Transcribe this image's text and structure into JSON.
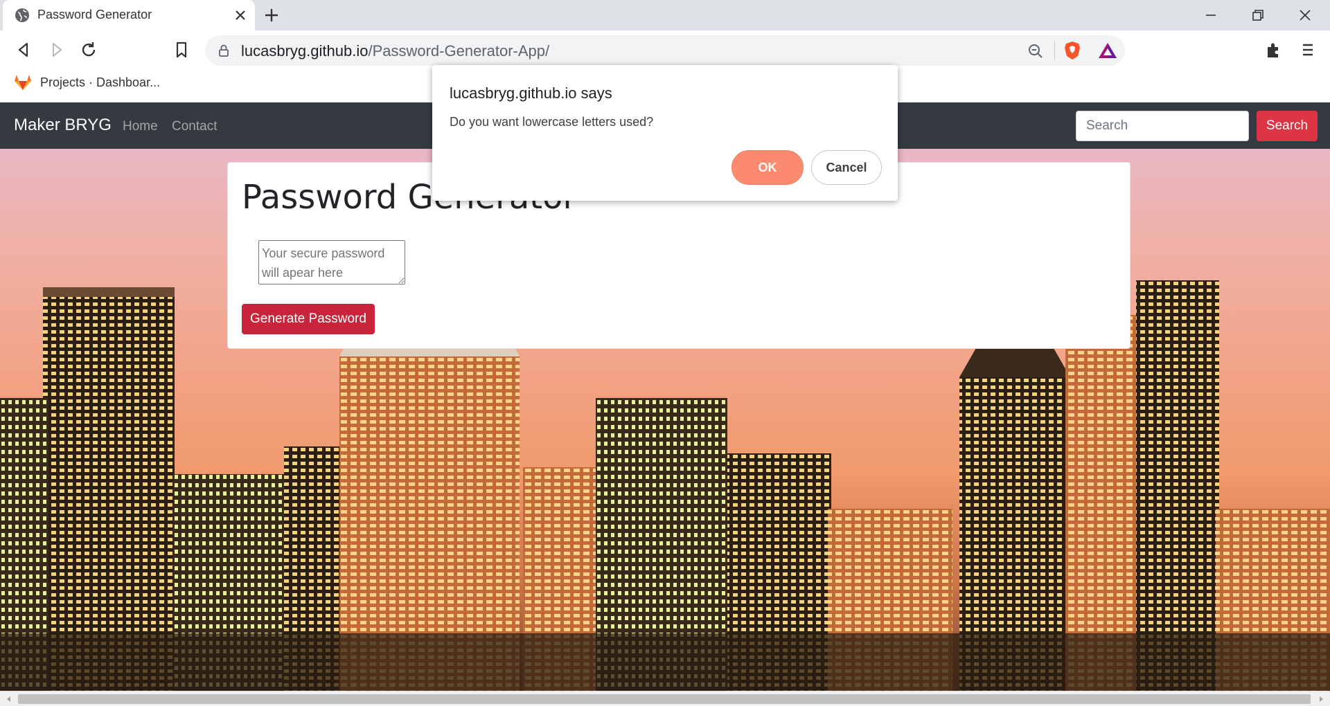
{
  "browser": {
    "tab_title": "Password Generator",
    "url_host": "lucasbryg.github.io",
    "url_path": "/Password-Generator-App/",
    "bookmark_label": "Projects · Dashboar..."
  },
  "navbar": {
    "brand": "Maker BRYG",
    "links": [
      "Home",
      "Contact"
    ],
    "search_placeholder": "Search",
    "search_button": "Search"
  },
  "card": {
    "title": "Password Generator",
    "password_placeholder": "Your secure password will apear here",
    "generate_button": "Generate Password"
  },
  "dialog": {
    "origin": "lucasbryg.github.io says",
    "message": "Do you want lowercase letters used?",
    "ok_label": "OK",
    "cancel_label": "Cancel"
  },
  "colors": {
    "navbar_bg": "#343a40",
    "danger": "#dc3545",
    "ok_button": "#fb8a6e"
  }
}
